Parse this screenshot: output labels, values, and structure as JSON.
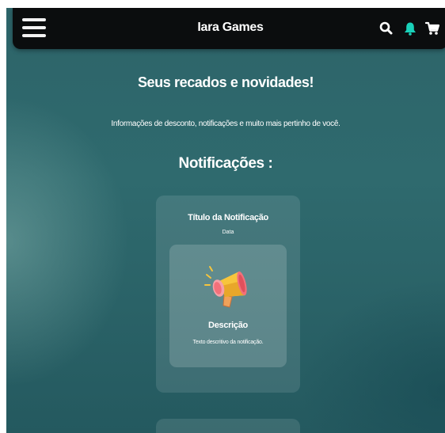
{
  "header": {
    "brand": "Iara Games",
    "icons": [
      "menu-icon",
      "search-icon",
      "bell-icon",
      "cart-icon"
    ],
    "bell_color": "#19d1b9"
  },
  "page": {
    "heading": "Seus recados e novidades!",
    "subheading": "Informações de desconto, notificações e muito mais pertinho de você.",
    "section_title": "Notificações :"
  },
  "notifications": [
    {
      "title": "Título da Notificação",
      "date": "Data",
      "icon": "megaphone-icon",
      "description_title": "Descrição",
      "description_text": "Texto descritivo da notificação."
    }
  ]
}
